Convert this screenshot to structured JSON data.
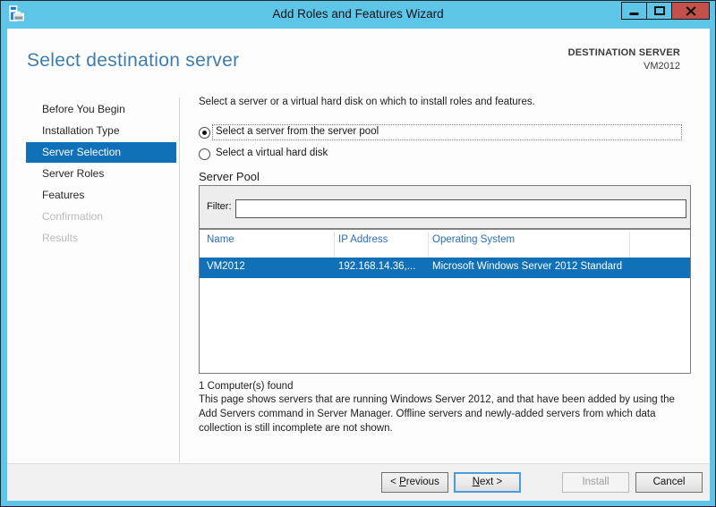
{
  "window": {
    "title": "Add Roles and Features Wizard",
    "icon": "add-roles-wizard-icon",
    "controls": {
      "minimize": "minimize",
      "maximize": "maximize",
      "close": "close"
    }
  },
  "header": {
    "page_title": "Select destination server",
    "destination_label": "DESTINATION SERVER",
    "destination_server": "VM2012"
  },
  "sidebar": {
    "items": [
      {
        "label": "Before You Begin",
        "state": "enabled"
      },
      {
        "label": "Installation Type",
        "state": "enabled"
      },
      {
        "label": "Server Selection",
        "state": "active"
      },
      {
        "label": "Server Roles",
        "state": "enabled"
      },
      {
        "label": "Features",
        "state": "enabled"
      },
      {
        "label": "Confirmation",
        "state": "disabled"
      },
      {
        "label": "Results",
        "state": "disabled"
      }
    ]
  },
  "main": {
    "intro": "Select a server or a virtual hard disk on which to install roles and features.",
    "radios": [
      {
        "label": "Select a server from the server pool",
        "selected": true
      },
      {
        "label": "Select a virtual hard disk",
        "selected": false
      }
    ],
    "server_pool": {
      "title": "Server Pool",
      "filter_label": "Filter:",
      "filter_value": "",
      "table": {
        "headers": [
          "Name",
          "IP Address",
          "Operating System"
        ],
        "rows": [
          {
            "name": "VM2012",
            "ip": "192.168.14.36,...",
            "os": "Microsoft Windows Server 2012 Standard",
            "selected": true
          }
        ]
      },
      "count_text": "1 Computer(s) found"
    },
    "description_lines": [
      "This page shows servers that are running Windows Server 2012, and that have been added by using the",
      "Add Servers command in Server Manager. Offline servers and newly-added servers from which data",
      "collection is still incomplete are not shown."
    ]
  },
  "footer": {
    "buttons": [
      {
        "label": "< Previous",
        "mnemonic": "P",
        "state": "enabled"
      },
      {
        "label": "Next >",
        "mnemonic": "N",
        "state": "default"
      },
      {
        "label": "Install",
        "mnemonic": "",
        "state": "disabled"
      },
      {
        "label": "Cancel",
        "mnemonic": "",
        "state": "enabled"
      }
    ]
  },
  "colors": {
    "chrome_blue": "#5dc6e8",
    "close_red": "#c4504b",
    "selection_blue": "#1070b8",
    "page_title_blue": "#3d7dac",
    "table_header_blue": "#2a6fb4",
    "footer_gray": "#f0f0f0"
  }
}
